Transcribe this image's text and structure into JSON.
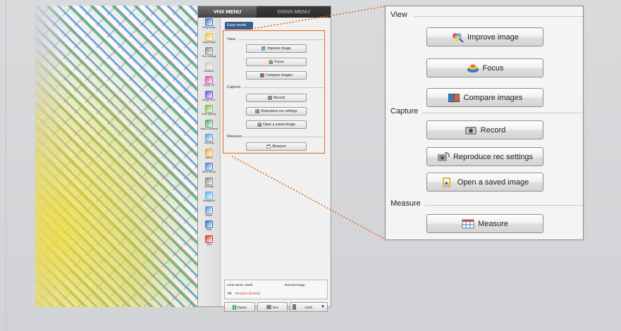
{
  "panel": {
    "tabs": [
      {
        "label": "VHX MENU",
        "active": true
      },
      {
        "label": "D5000 MENU",
        "active": false
      }
    ],
    "sidebar": [
      {
        "label": "Easy mode",
        "icon": "wand-icon",
        "color": "#3a78c8"
      },
      {
        "label": "Light/Bright",
        "icon": "bulb-icon",
        "color": "#e8c43a"
      },
      {
        "label": "Rec settings",
        "icon": "record-settings-icon",
        "color": "#8a8a8a"
      },
      {
        "label": "Measure",
        "icon": "ruler-icon",
        "color": "#c7c7c7"
      },
      {
        "label": "Depth UP",
        "icon": "depth-icon",
        "color": "#d84fa8"
      },
      {
        "label": "Image Enh.",
        "icon": "image-enhance-icon",
        "color": "#6a4fd8"
      },
      {
        "label": "Multi-lighting",
        "icon": "lighting-icon",
        "color": "#7ab84a"
      },
      {
        "label": "Marc/Comment",
        "icon": "comment-icon",
        "color": "#4fa86a"
      },
      {
        "label": "Stitching",
        "icon": "stitch-icon",
        "color": "#5f9fd0"
      },
      {
        "label": "Album",
        "icon": "album-icon",
        "color": "#e8a83a"
      },
      {
        "label": "Sites Album",
        "icon": "sites-album-icon",
        "color": "#4a86c8"
      },
      {
        "label": "Settings",
        "icon": "tools-icon",
        "color": "#888888"
      },
      {
        "label": "Navigation",
        "icon": "navigation-icon",
        "color": "#5cb0e8"
      },
      {
        "label": "Home",
        "icon": "home-icon",
        "color": "#5a8ed0"
      },
      {
        "label": "Help",
        "icon": "help-icon",
        "color": "#2f6fc8"
      },
      {
        "label": "Quit",
        "icon": "power-icon",
        "color": "#d83a3a"
      }
    ],
    "easy_tab": "Easy mode",
    "sections": {
      "view": "View",
      "capture": "Capture",
      "measure": "Measure"
    },
    "buttons": {
      "improve": "Improve image",
      "focus": "Focus",
      "compare": "Compare images",
      "record": "Record",
      "reproduce": "Reproduce rec settings",
      "open": "Open a saved image",
      "measure": "Measure"
    },
    "status": {
      "lens": "Lens name: ZS20",
      "mode": "Normal image",
      "tilt_label": "Tilt:",
      "tilt_value": "0Degree (locked)"
    },
    "bottom": {
      "pause": "Pause",
      "rec": "Rec",
      "zoom": "X200"
    }
  },
  "zoom": {
    "sections": {
      "view": "View",
      "capture": "Capture",
      "measure": "Measure"
    },
    "buttons": {
      "improve": "Improve image",
      "focus": "Focus",
      "compare": "Compare images",
      "record": "Record",
      "reproduce": "Reproduce rec settings",
      "open": "Open a saved image",
      "measure": "Measure"
    }
  },
  "colors": {
    "highlight": "#e26d1c",
    "tab_active": "#3b5b8d",
    "tilt_value": "#d03a2a"
  }
}
